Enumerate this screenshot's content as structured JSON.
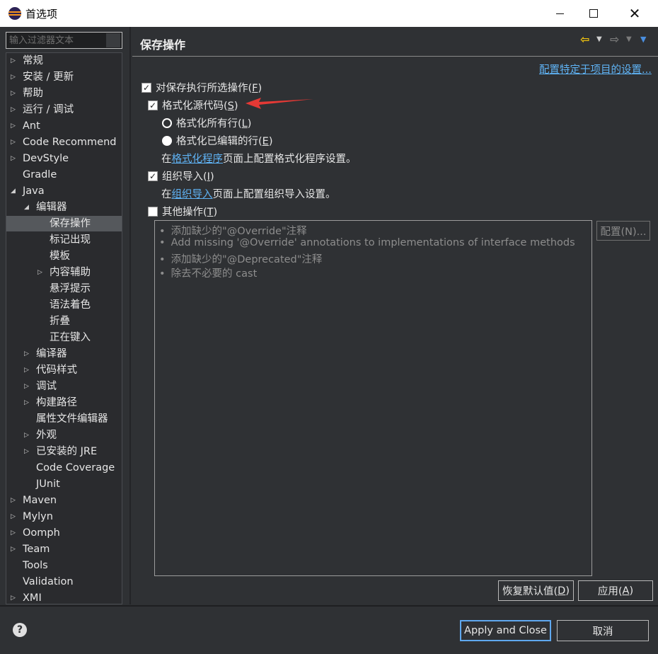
{
  "window": {
    "title": "首选项"
  },
  "filter": {
    "placeholder": "输入过滤器文本"
  },
  "tree": {
    "items": [
      {
        "label": "常规",
        "twisty": "▷"
      },
      {
        "label": "安装 / 更新",
        "twisty": "▷"
      },
      {
        "label": "帮助",
        "twisty": "▷"
      },
      {
        "label": "运行 / 调试",
        "twisty": "▷"
      },
      {
        "label": "Ant",
        "twisty": "▷"
      },
      {
        "label": "Code Recommend",
        "twisty": "▷"
      },
      {
        "label": "DevStyle",
        "twisty": "▷"
      },
      {
        "label": "Gradle",
        "twisty": ""
      },
      {
        "label": "Java",
        "twisty": "◢"
      },
      {
        "label": "编辑器",
        "twisty": "◢"
      },
      {
        "label": "保存操作",
        "twisty": ""
      },
      {
        "label": "标记出现",
        "twisty": ""
      },
      {
        "label": "模板",
        "twisty": ""
      },
      {
        "label": "内容辅助",
        "twisty": "▷"
      },
      {
        "label": "悬浮提示",
        "twisty": ""
      },
      {
        "label": "语法着色",
        "twisty": ""
      },
      {
        "label": "折叠",
        "twisty": ""
      },
      {
        "label": "正在键入",
        "twisty": ""
      },
      {
        "label": "编译器",
        "twisty": "▷"
      },
      {
        "label": "代码样式",
        "twisty": "▷"
      },
      {
        "label": "调试",
        "twisty": "▷"
      },
      {
        "label": "构建路径",
        "twisty": "▷"
      },
      {
        "label": "属性文件编辑器",
        "twisty": ""
      },
      {
        "label": "外观",
        "twisty": "▷"
      },
      {
        "label": "已安装的 JRE",
        "twisty": "▷"
      },
      {
        "label": "Code Coverage",
        "twisty": ""
      },
      {
        "label": "JUnit",
        "twisty": ""
      },
      {
        "label": "Maven",
        "twisty": "▷"
      },
      {
        "label": "Mylyn",
        "twisty": "▷"
      },
      {
        "label": "Oomph",
        "twisty": "▷"
      },
      {
        "label": "Team",
        "twisty": "▷"
      },
      {
        "label": "Tools",
        "twisty": ""
      },
      {
        "label": "Validation",
        "twisty": ""
      },
      {
        "label": "XMI",
        "twisty": "▷"
      }
    ]
  },
  "page": {
    "title": "保存操作",
    "project_link": "配置特定于项目的设置...",
    "perform_selected": {
      "label": "对保存执行所选操作(",
      "mnemonic": "F",
      "suffix": ")",
      "checked": "✓"
    },
    "format_source": {
      "label": "格式化源代码(",
      "mnemonic": "S",
      "suffix": ")",
      "checked": "✓"
    },
    "format_all": {
      "label": "格式化所有行(",
      "mnemonic": "L",
      "suffix": ")"
    },
    "format_edited": {
      "label": "格式化已编辑的行(",
      "mnemonic": "E",
      "suffix": ")"
    },
    "formatter_info": {
      "prefix": "在",
      "link": "格式化程序",
      "suffix": "页面上配置格式化程序设置。"
    },
    "organize_imports": {
      "label": "组织导入(",
      "mnemonic": "I",
      "suffix": ")",
      "checked": "✓"
    },
    "imports_info": {
      "prefix": "在",
      "link": "组织导入",
      "suffix": "页面上配置组织导入设置。"
    },
    "other_actions": {
      "label": "其他操作(",
      "mnemonic": "T",
      "suffix": ")"
    },
    "actions_list": [
      "添加缺少的\"@Override\"注释",
      "Add missing '@Override' annotations to implementations of interface methods",
      "添加缺少的\"@Deprecated\"注释",
      "除去不必要的 cast"
    ],
    "bullet": "•",
    "configure_btn": "配置(N)...",
    "restore_defaults": {
      "label": "恢复默认值(",
      "mnemonic": "D",
      "suffix": ")"
    },
    "apply": {
      "label": "应用(",
      "mnemonic": "A",
      "suffix": ")"
    }
  },
  "footer": {
    "help": "?",
    "apply_close": "Apply and Close",
    "cancel": "取消"
  },
  "colors": {
    "link": "#5fb3f5",
    "selection": "#55585c",
    "arrow": "#e53935",
    "default_button_border": "#5fa8ef"
  }
}
